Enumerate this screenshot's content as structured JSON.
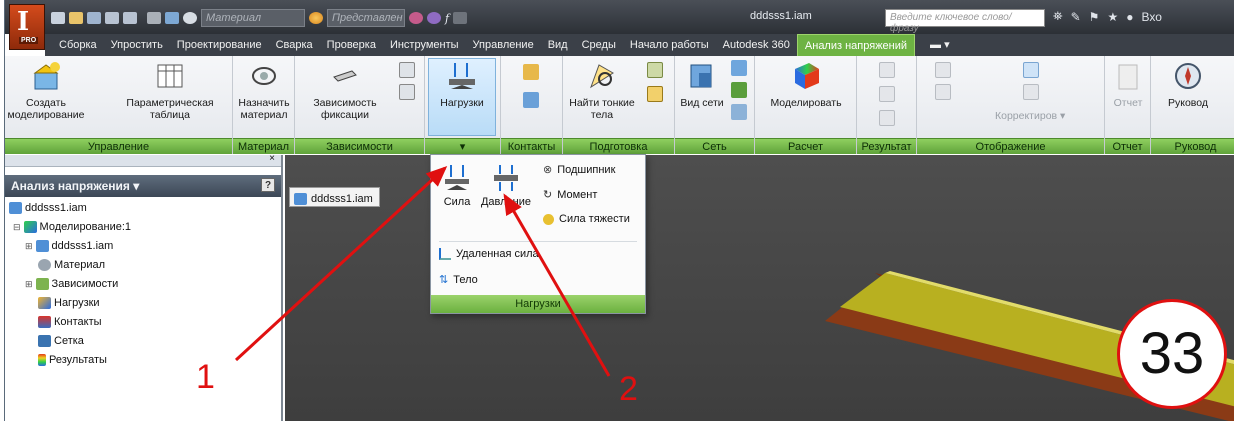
{
  "app": {
    "logo_letter": "I",
    "logo_badge": "PRO",
    "document_title": "dddsss1.iam"
  },
  "quick_access": {
    "material_combo": "Материал",
    "appearance_combo": "Представлен",
    "fx_symbol": "f"
  },
  "search": {
    "placeholder": "Введите ключевое слово/фразу"
  },
  "user": {
    "sign_in": "Вхо"
  },
  "tabs": [
    "Сборка",
    "Упростить",
    "Проектирование",
    "Сварка",
    "Проверка",
    "Инструменты",
    "Управление",
    "Вид",
    "Среды",
    "Начало работы",
    "Autodesk 360",
    "Анализ напряжений"
  ],
  "active_tab": "Анализ напряжений",
  "ribbon": {
    "create_sim": "Создать моделирование",
    "param_table": "Параметрическая таблица",
    "panel_manage": "Управление",
    "assign_material": "Назначить материал",
    "panel_material": "Материал",
    "fixed_constraint": "Зависимость фиксации",
    "panel_constraints": "Зависимости",
    "loads": "Нагрузки",
    "panel_contacts": "Контакты",
    "find_thin": "Найти тонкие тела",
    "panel_prepare": "Подготовка",
    "mesh_view": "Вид сети",
    "panel_mesh": "Сеть",
    "simulate": "Моделировать",
    "panel_solve": "Расчет",
    "panel_result": "Результат",
    "adjustments": "Корректиров",
    "panel_display": "Отображение",
    "report": "Отчет",
    "panel_report": "Отчет",
    "guide": "Руковод",
    "panel_guide": "Руковод"
  },
  "loads_dropdown": {
    "force": "Сила",
    "pressure": "Давление",
    "bearing": "Подшипник",
    "moment": "Момент",
    "gravity": "Сила тяжести",
    "remote_force": "Удаленная сила",
    "body": "Тело",
    "footer": "Нагрузки"
  },
  "browser": {
    "title": "Анализ напряжения",
    "root": "dddsss1.iam",
    "items": [
      {
        "label": "Моделирование:1",
        "icon": "simulation-icon"
      },
      {
        "label": "dddsss1.iam",
        "icon": "assembly-icon"
      },
      {
        "label": "Материал",
        "icon": "material-icon"
      },
      {
        "label": "Зависимости",
        "icon": "constraints-icon"
      },
      {
        "label": "Нагрузки",
        "icon": "loads-icon"
      },
      {
        "label": "Контакты",
        "icon": "contacts-icon"
      },
      {
        "label": "Сетка",
        "icon": "mesh-icon"
      },
      {
        "label": "Результаты",
        "icon": "results-icon"
      }
    ]
  },
  "viewport": {
    "tab_label": "dddsss1.iam"
  },
  "annotations": {
    "callout_1": "1",
    "callout_2": "2",
    "slide_number": "33"
  },
  "colors": {
    "accent_green": "#6eb343",
    "callout_red": "#e01010",
    "titlebar": "#2c3036"
  }
}
